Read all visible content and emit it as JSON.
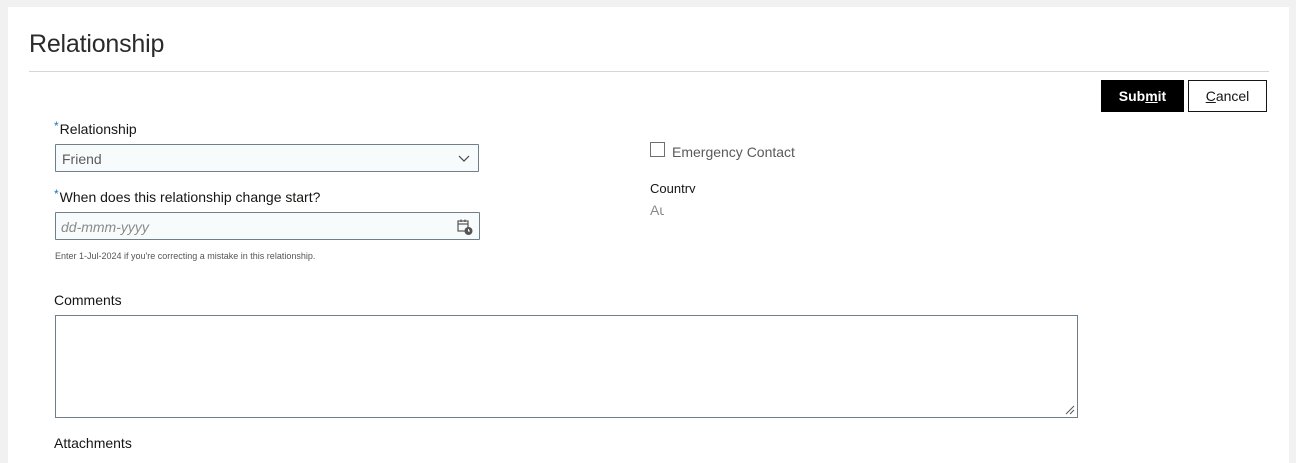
{
  "page": {
    "title": "Relationship"
  },
  "actions": {
    "submit_label_pre": "Sub",
    "submit_label_u": "m",
    "submit_label_post": "it",
    "cancel_label_u": "C",
    "cancel_label_post": "ancel"
  },
  "form": {
    "relationship": {
      "required_mark": "*",
      "label": "Relationship",
      "value": "Friend",
      "icon": "chevron-down-icon"
    },
    "start_date": {
      "required_mark": "*",
      "label": "When does this relationship change start?",
      "placeholder": "dd-mmm-yyyy",
      "hint": "Enter 1-Jul-2024 if you're correcting a mistake in this relationship.",
      "icon": "calendar-icon"
    },
    "emergency_contact": {
      "label": "Emergency Contact",
      "checked": false
    },
    "country": {
      "label": "Country",
      "value": "Au"
    },
    "comments": {
      "label": "Comments",
      "value": ""
    },
    "attachments": {
      "label": "Attachments"
    }
  },
  "colors": {
    "required": "#1a73c5",
    "submit_bg": "#000000",
    "field_border": "#6f7e89",
    "page_bg": "#f1f1f1"
  }
}
